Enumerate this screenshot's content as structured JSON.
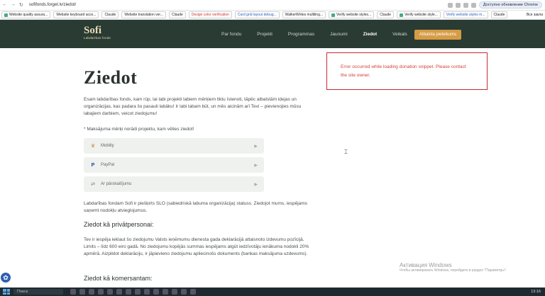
{
  "browser": {
    "url": "sofifonds.forget.lv/ziedot/",
    "update_label": "Доступно обновление Chrome",
    "bookmarks": [
      "Website quality assura...",
      "Website keyboard acce...",
      "Claude",
      "Website translation ver...",
      "Claude",
      "Design color verification",
      "Card grid layout debug...",
      "WalkerWrites multiling...",
      "Verify website styles...",
      "Claude",
      "Verify website style...",
      "Verify website styles m...",
      "Claude"
    ],
    "all_bookmarks": "Все закла"
  },
  "header": {
    "logo_name": "Sofi",
    "logo_sub": "Labdarības fonds",
    "nav": [
      "Par fondu",
      "Projekti",
      "Programmas",
      "Jaunumi",
      "Ziedot",
      "Veikals"
    ],
    "cta": "Atbalsta pieteikums"
  },
  "main": {
    "title": "Ziedot",
    "intro": "Esam labdarības fonds, kam rūp, lai labi projekti labiem mērķiem tiktu īstenoti, tāpēc atbalstām idejas un organizācijas, kas padara šo pasauli labāku! Ir labi labam būt, un mēs aicinām arī Tevi – pievienojies mūsu labajiem darbiem, veicot ziedojumu!",
    "note": "* Maksājuma mērķi norādi projektu, kam vēlies ziedot!",
    "payments": [
      {
        "label": "Mobilly",
        "icon": "mobilly-icon"
      },
      {
        "label": "PayPal",
        "icon": "paypal-icon"
      },
      {
        "label": "Ar pārskaitījumu",
        "icon": "bank-transfer-icon"
      }
    ],
    "status_text": "Labdarības fondam Sofi ir piešķirts SLO (sabiedriskā labuma organizācija) statuss. Ziedojot mums, iespējams saņemt nodokļu atvieglojumus.",
    "private_heading": "Ziedot kā privātpersonai:",
    "private_text": "Tev ir iespēja ieklaut šo ziedojumu Valsts ieņēmumu dienesta gada deklarācijā attaisnoto izdevumu pozīcijā. Limits – līdz 600 eiro gadā. No ziedojumu kopējās summas iespējams atgūt iedzīvotāju ienākuma nodokli 20% apmērā. Aizpildot deklarāciju, ir jāpievieno ziedojumu apliecinošs dokuments (bankas maksājuma uzdevums).",
    "business_heading": "Ziedot kā komersantam:"
  },
  "error": {
    "message": "Error occurred while loading donation snippet. Please contact the site owner."
  },
  "watermark": {
    "title": "Активация Windows",
    "text": "Чтобы активировать Windows, перейдите в раздел \"Параметры\"."
  },
  "taskbar": {
    "search": "Поиск",
    "time": "13:16"
  }
}
